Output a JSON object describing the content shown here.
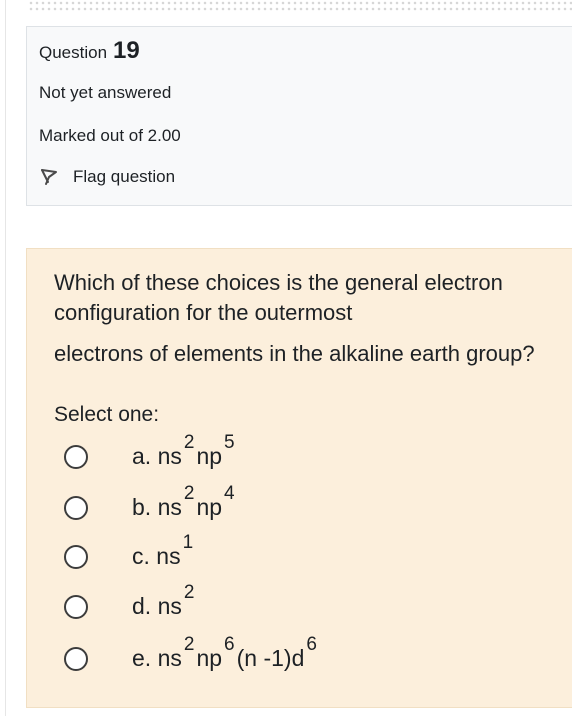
{
  "info": {
    "question_label": "Question",
    "question_number": "19",
    "state": "Not yet answered",
    "grade": "Marked out of 2.00",
    "flag_label": "Flag question",
    "flag_icon": "flag-icon"
  },
  "question": {
    "line1": "Which of these choices is the general electron",
    "line2": "configuration for the outermost",
    "line3": "electrons of elements in the alkaline earth group?",
    "prompt": "Select one:"
  },
  "options": [
    {
      "letter": "a.",
      "parts": [
        {
          "base": "ns",
          "sup": "2"
        },
        {
          "base": "np",
          "sup": "5"
        }
      ],
      "tail": ""
    },
    {
      "letter": "b.",
      "parts": [
        {
          "base": "ns",
          "sup": "2"
        },
        {
          "base": "np",
          "sup": "4"
        }
      ],
      "tail": ""
    },
    {
      "letter": "c.",
      "parts": [
        {
          "base": "ns",
          "sup": "1"
        }
      ],
      "tail": ""
    },
    {
      "letter": "d.",
      "parts": [
        {
          "base": "ns",
          "sup": "2"
        }
      ],
      "tail": ""
    },
    {
      "letter": "e.",
      "parts": [
        {
          "base": "ns",
          "sup": "2"
        },
        {
          "base": "np",
          "sup": "6"
        },
        {
          "base": "(n -1)d",
          "sup": "6"
        }
      ],
      "tail": ""
    }
  ],
  "colors": {
    "info_bg": "#f8f9fa",
    "content_bg": "#fcefdc",
    "text": "#1d2125"
  }
}
